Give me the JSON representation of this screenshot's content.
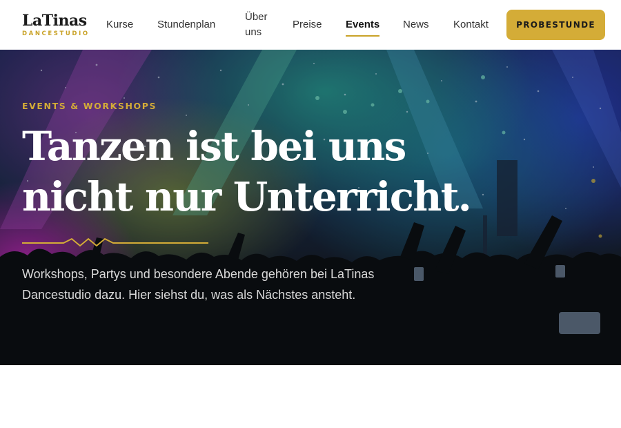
{
  "logo": {
    "name": "LaTinas",
    "subtitle": "DANCESTUDIO"
  },
  "nav": {
    "items": [
      {
        "label": "Kurse"
      },
      {
        "label": "Stundenplan"
      },
      {
        "label": "Über uns"
      },
      {
        "label": "Preise"
      },
      {
        "label": "Events",
        "active": true
      },
      {
        "label": "News"
      },
      {
        "label": "Kontakt"
      }
    ],
    "cta_label": "PROBESTUNDE"
  },
  "hero": {
    "eyebrow": "EVENTS & WORKSHOPS",
    "headline": "Tanzen ist bei uns nicht nur Unterricht.",
    "lead": "Workshops, Partys und besondere Abende gehören bei LaTinas Dancestudio dazu. Hier siehst du, was als Nächstes ansteht."
  },
  "colors": {
    "accent": "#d4ac37",
    "brand_gold": "#c9a227",
    "text_dark": "#1c1c1c",
    "hero_text": "#ffffff",
    "lead_text": "#d9d9d9"
  }
}
